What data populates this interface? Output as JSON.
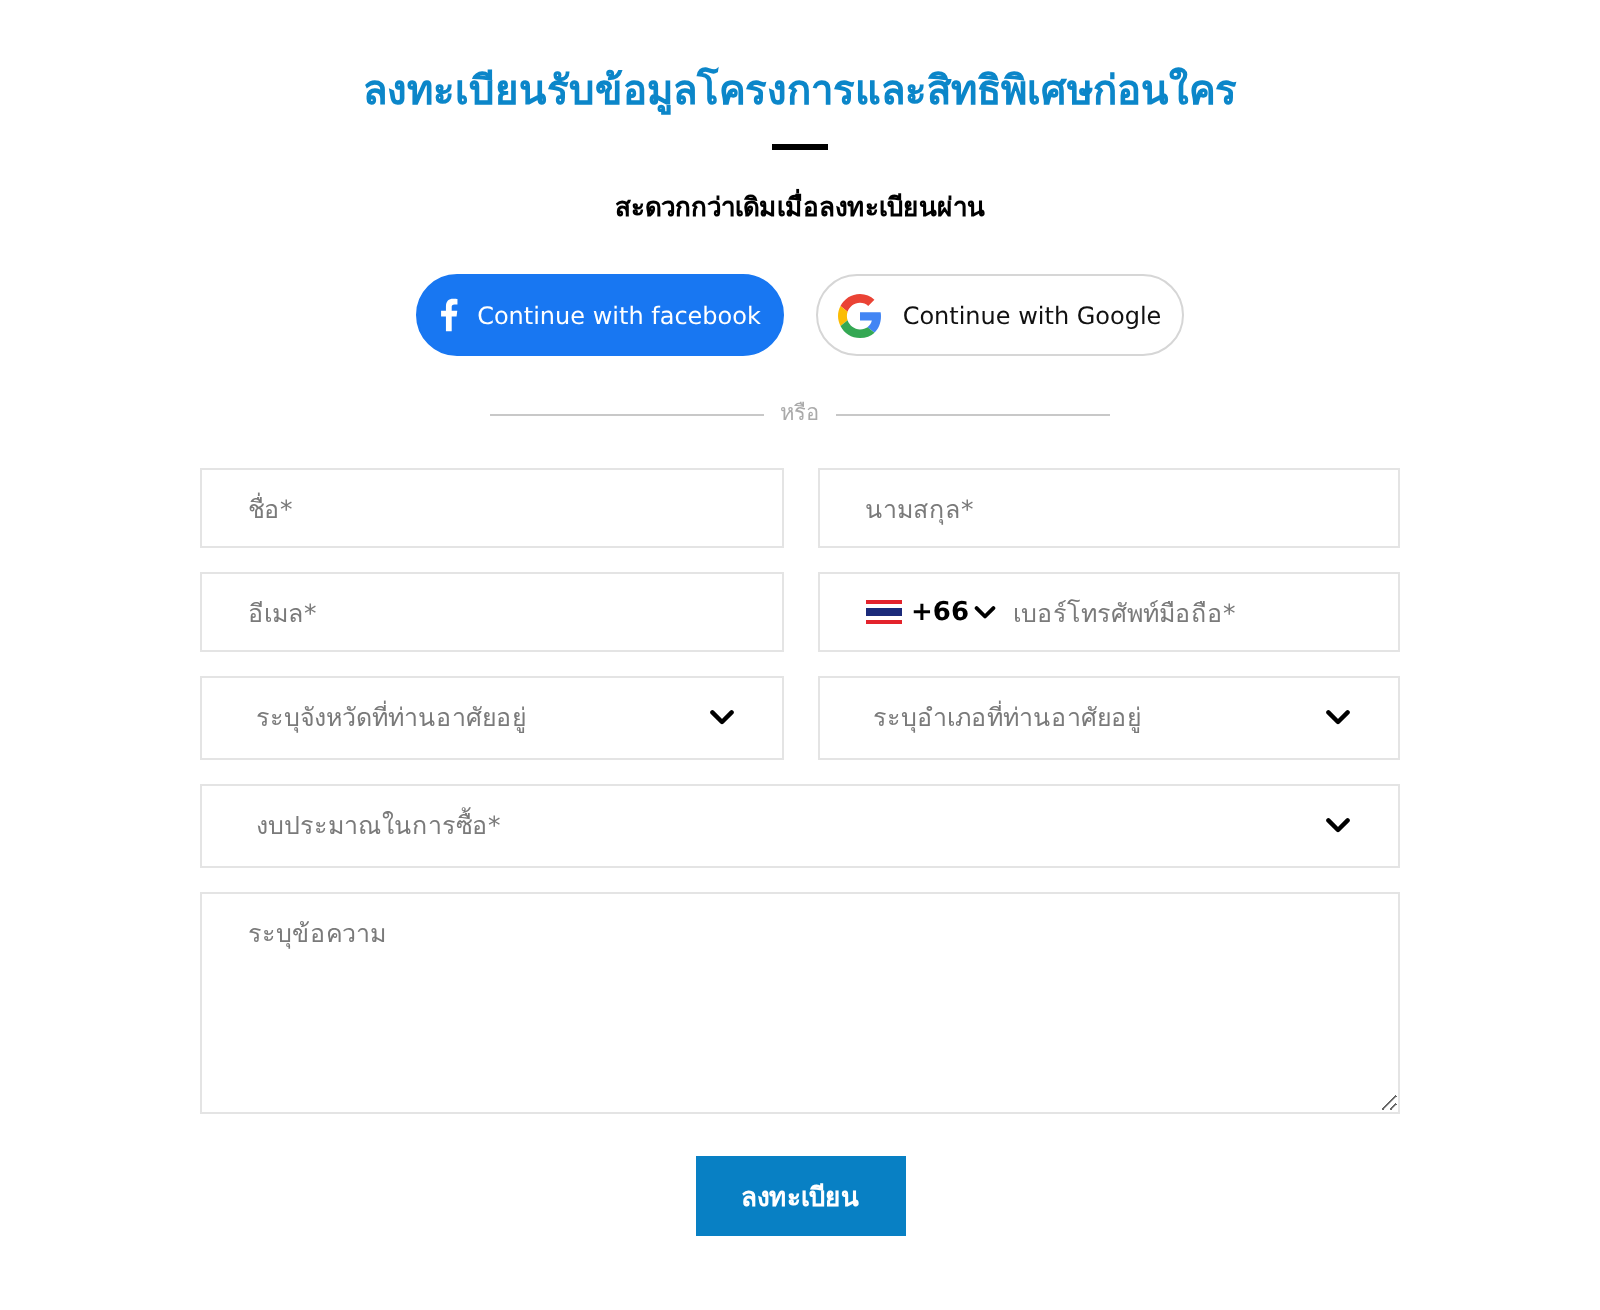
{
  "heading": {
    "title": "ลงทะเบียนรับข้อมูลโครงการและสิทธิพิเศษก่อนใคร",
    "subtitle": "สะดวกกว่าเดิมเมื่อลงทะเบียนผ่าน"
  },
  "social_buttons": [
    {
      "kind": "facebook",
      "label": "Continue with facebook"
    },
    {
      "kind": "google",
      "label": "Continue with Google"
    }
  ],
  "divider": {
    "label": "หรือ"
  },
  "fields": [
    {
      "kind": "text",
      "placeholder": "ชื่อ*"
    },
    {
      "kind": "text",
      "placeholder": "นามสกุล*"
    },
    {
      "kind": "text",
      "placeholder": "อีเมล*"
    },
    {
      "kind": "phone",
      "country_code": "+66",
      "placeholder": "เบอร์โทรศัพท์มือถือ*"
    },
    {
      "kind": "select",
      "placeholder": "ระบุจังหวัดที่ท่านอาศัยอยู่"
    },
    {
      "kind": "select",
      "placeholder": "ระบุอำเภอที่ท่านอาศัยอยู่"
    },
    {
      "kind": "select",
      "placeholder": "งบประมาณในการซื้อ*",
      "wide": true
    },
    {
      "kind": "textarea",
      "placeholder": "ระบุข้อความ"
    }
  ],
  "submit_button": {
    "label": "ลงทะเบียน"
  }
}
